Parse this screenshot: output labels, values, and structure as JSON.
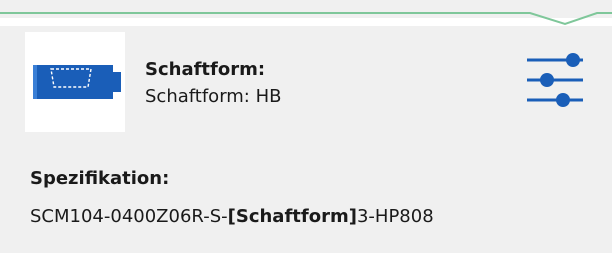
{
  "shaft": {
    "label": "Schaftform:",
    "value": "Schaftform: HB"
  },
  "spec": {
    "label": "Spezifikation:",
    "prefix": "SCM104-0400Z06R-S-",
    "bracket_open": "[",
    "bracket_term": "Schaftform",
    "bracket_close": "]",
    "suffix": "3-HP808"
  },
  "icons": {
    "product": "shank-shape-icon",
    "filter": "filter-sliders-icon"
  },
  "colors": {
    "accent_green": "#7fc79a",
    "icon_blue": "#1a5eb8",
    "panel_bg": "#f0f0f0"
  }
}
